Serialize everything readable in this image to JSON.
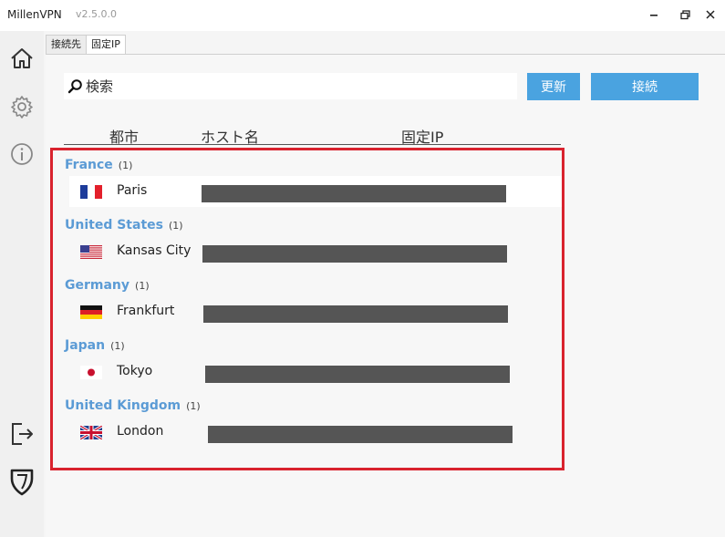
{
  "window": {
    "app_name": "MillenVPN",
    "version": "v2.5.0.0"
  },
  "tabs": [
    {
      "label": "接続先",
      "active": false
    },
    {
      "label": "固定IP",
      "active": true
    }
  ],
  "search": {
    "placeholder": "検索"
  },
  "buttons": {
    "refresh": "更新",
    "connect": "接続"
  },
  "columns": {
    "city": "都市",
    "host": "ホスト名",
    "ip": "固定IP"
  },
  "groups": [
    {
      "country": "France",
      "count": "(1)",
      "city": "Paris",
      "flag": "france-flag"
    },
    {
      "country": "United States",
      "count": "(1)",
      "city": "Kansas City",
      "flag": "usa-flag"
    },
    {
      "country": "Germany",
      "count": "(1)",
      "city": "Frankfurt",
      "flag": "germany-flag"
    },
    {
      "country": "Japan",
      "count": "(1)",
      "city": "Tokyo",
      "flag": "japan-flag"
    },
    {
      "country": "United Kingdom",
      "count": "(1)",
      "city": "London",
      "flag": "uk-flag"
    }
  ],
  "colors": {
    "accent": "#4aa3e0",
    "country_text": "#5b9bd5",
    "highlight_frame": "#d9232e",
    "redaction": "#555555"
  }
}
